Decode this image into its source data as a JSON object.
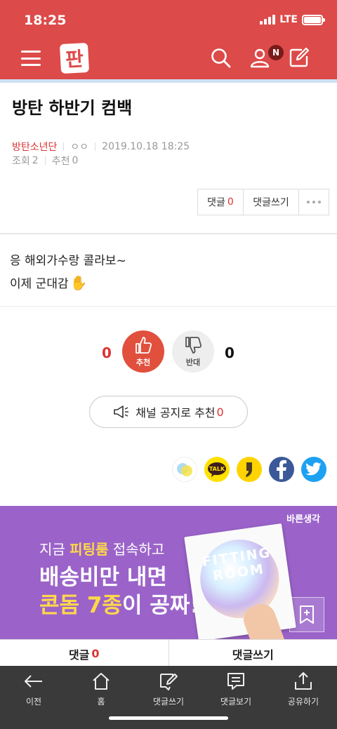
{
  "status": {
    "time": "18:25",
    "network": "LTE"
  },
  "header": {
    "logo": "판",
    "notification_badge": "N"
  },
  "article": {
    "title": "방탄 하반기 컴백",
    "channel": "방탄소년단",
    "author": "ㅇㅇ",
    "date": "2019.10.18 18:25",
    "views_label": "조회",
    "views": "2",
    "recommend_label": "추천",
    "recommend": "0",
    "body_line1": "응 해외가수랑 콜라보~",
    "body_line2": "이제 군대감",
    "emoji": "✋"
  },
  "actions": {
    "comment_label": "댓글",
    "comment_count": "0",
    "write_comment": "댓글쓰기"
  },
  "vote": {
    "up_count": "0",
    "up_label": "추천",
    "down_label": "반대",
    "down_count": "0"
  },
  "notice": {
    "label": "채널 공지로 추천",
    "count": "0"
  },
  "share_icons": [
    "channel-share-icon",
    "kakaotalk-icon",
    "kakaostory-icon",
    "facebook-icon",
    "twitter-icon"
  ],
  "share": {
    "talk_text": "TALK"
  },
  "banner": {
    "brand": "바른생각",
    "line1_pre": "지금",
    "line1_highlight": "피팅룸",
    "line1_post": "접속하고",
    "line2": "배송비만 내면",
    "line3_highlight": "콘돔 7종",
    "line3_post": "이 공짜!",
    "product_text1": "FITTING",
    "product_text2": "ROOM"
  },
  "comment_bar": {
    "comment_label": "댓글",
    "comment_count": "0",
    "write_label": "댓글쓰기"
  },
  "bottom_nav": {
    "back": "이전",
    "home": "홈",
    "write": "댓글쓰기",
    "view": "댓글보기",
    "share": "공유하기"
  },
  "colors": {
    "brand_red": "#dd4a4a",
    "accent_red": "#d33",
    "banner_purple": "#9b63c9",
    "highlight_yellow": "#ffd84a",
    "nav_dark": "#3a3a3a"
  }
}
